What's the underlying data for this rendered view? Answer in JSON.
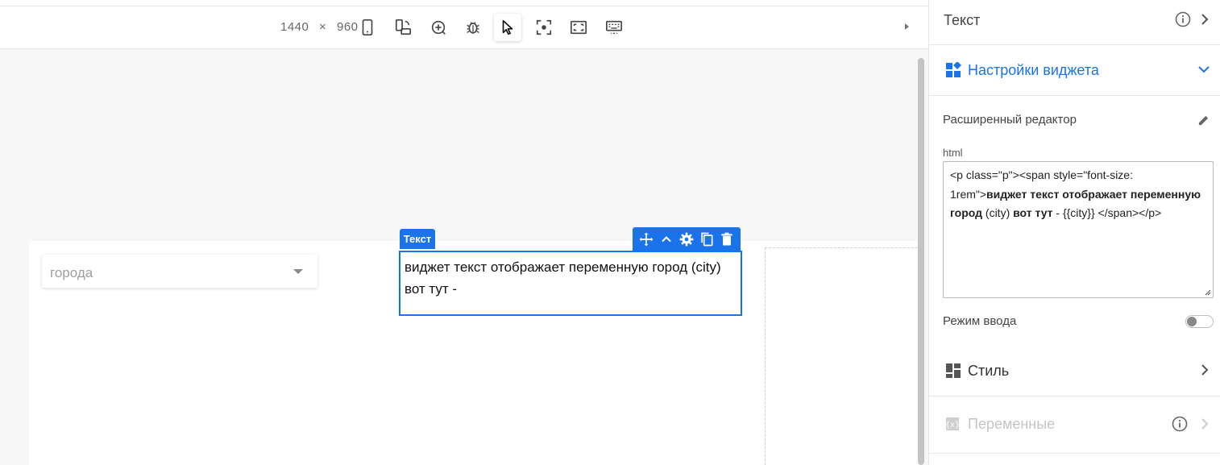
{
  "toolbar": {
    "width": "1440",
    "times": "×",
    "height": "960",
    "icons": [
      "phone-icon",
      "rotate-device-icon",
      "zoom-in-icon",
      "bug-icon",
      "cursor-icon",
      "focus-icon",
      "fullscreen-icon",
      "keyboard-icon"
    ]
  },
  "canvas": {
    "select_value": "города",
    "widget_tag": "Текст",
    "widget_text": "виджет текст отображает переменную город (city) вот тут -"
  },
  "panel": {
    "header_title": "Текст",
    "widget_settings_title": "Настройки виджета",
    "advanced_editor_label": "Расширенный редактор",
    "html_label": "html",
    "html_code_part1": "<p class=\"p\"><span style=\"font-size: 1rem\">",
    "html_code_bold1": "виджет текст отображает переменную город",
    "html_code_part2": " (city) ",
    "html_code_bold2": "вот тут",
    "html_code_part3": " - {{city}} </span></p>",
    "input_mode_label": "Режим ввода",
    "input_mode_on": false,
    "style_title": "Стиль",
    "variables_title": "Переменные",
    "accent_color": "#1a73e8"
  }
}
